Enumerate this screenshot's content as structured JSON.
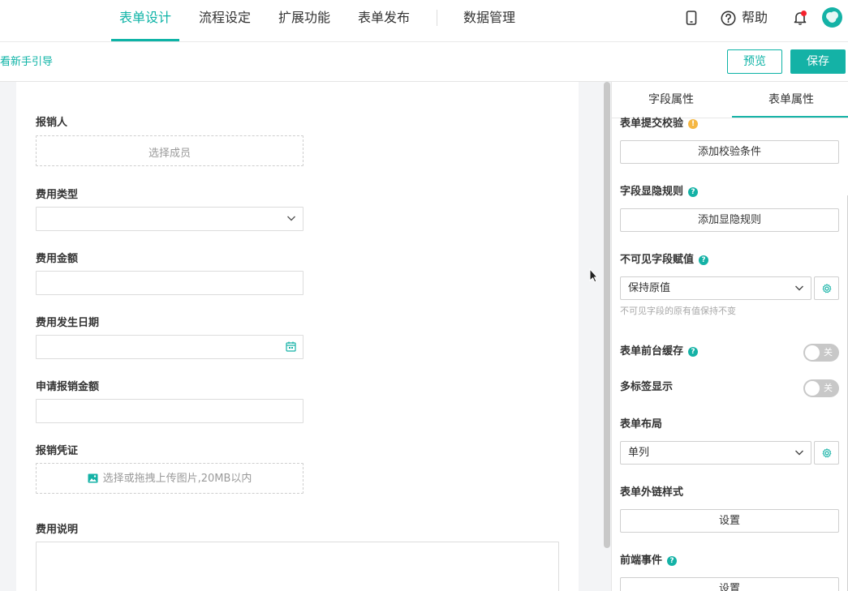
{
  "nav": {
    "tabs": [
      {
        "label": "表单设计",
        "active": true
      },
      {
        "label": "流程设定",
        "active": false
      },
      {
        "label": "扩展功能",
        "active": false
      },
      {
        "label": "表单发布",
        "active": false
      },
      {
        "label": "数据管理",
        "active": false
      }
    ],
    "help_label": "帮助",
    "icons": [
      "mobile-icon",
      "help-icon",
      "bell-icon",
      "avatar"
    ]
  },
  "toolbar": {
    "guide_link": "看新手引导",
    "preview_label": "预览",
    "save_label": "保存"
  },
  "form": {
    "fields": [
      {
        "label": "报销人",
        "placeholder": "选择成员",
        "kind": "member-picker"
      },
      {
        "label": "费用类型",
        "placeholder": "",
        "kind": "select"
      },
      {
        "label": "费用金额",
        "placeholder": "",
        "kind": "number"
      },
      {
        "label": "费用发生日期",
        "placeholder": "",
        "kind": "date"
      },
      {
        "label": "申请报销金额",
        "placeholder": "",
        "kind": "number"
      },
      {
        "label": "报销凭证",
        "placeholder": "选择或拖拽上传图片,20MB以内",
        "kind": "image-upload"
      },
      {
        "label": "费用说明",
        "placeholder": "",
        "kind": "textarea"
      }
    ]
  },
  "panel": {
    "tabs": [
      {
        "label": "字段属性",
        "active": false
      },
      {
        "label": "表单属性",
        "active": true
      }
    ],
    "submit_check": {
      "title": "表单提交校验",
      "button": "添加校验条件"
    },
    "visibility_rule": {
      "title": "字段显隐规则",
      "button": "添加显隐规则"
    },
    "invisible_value": {
      "title": "不可见字段赋值",
      "value": "保持原值",
      "hint": "不可见字段的原有值保持不变"
    },
    "front_cache": {
      "title": "表单前台缓存",
      "state": "关"
    },
    "multi_tab": {
      "title": "多标签显示",
      "state": "关"
    },
    "layout": {
      "title": "表单布局",
      "value": "单列"
    },
    "external_style": {
      "title": "表单外链样式",
      "button": "设置"
    },
    "frontend_event": {
      "title": "前端事件",
      "button": "设置"
    }
  },
  "colors": {
    "accent": "#14b2a6",
    "warn": "#f5b743",
    "notify": "#f5222d"
  }
}
